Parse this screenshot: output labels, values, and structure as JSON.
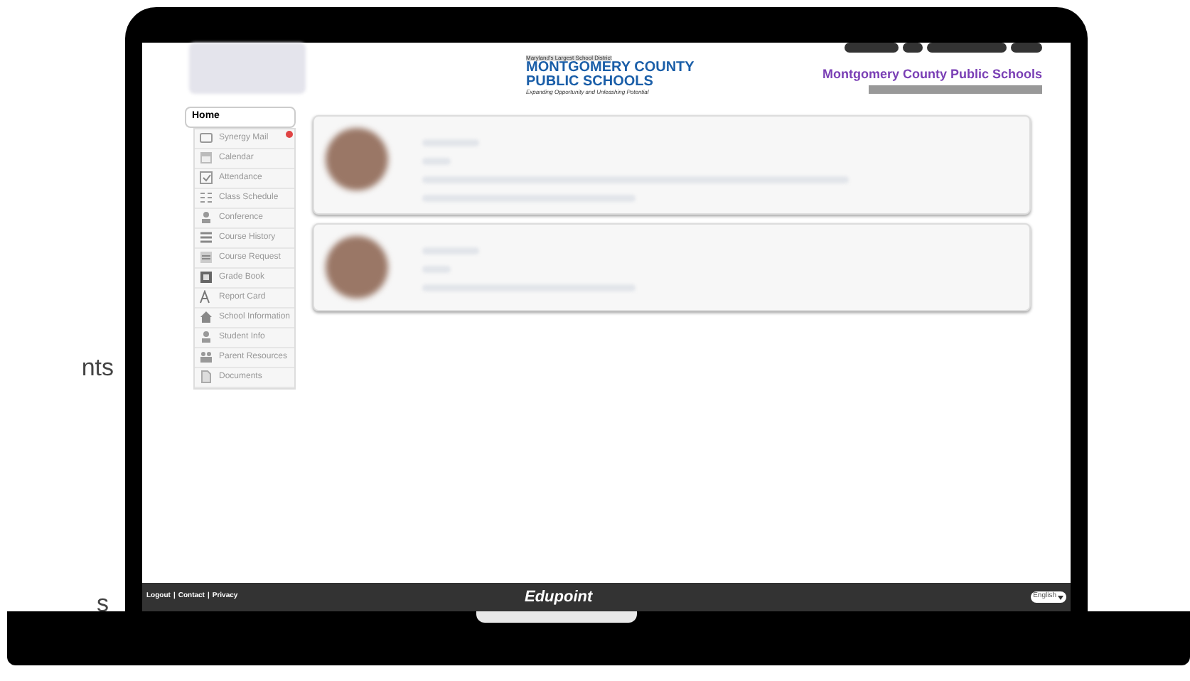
{
  "page_fragments": [
    "nts",
    "s"
  ],
  "header": {
    "logo": {
      "kicker": "Maryland's Largest School District",
      "line_1": "MONTGOMERY COUNTY",
      "line_2": "PUBLIC SCHOOLS",
      "tagline": "Expanding Opportunity and Unleashing Potential"
    },
    "title": "Montgomery County Public Schools"
  },
  "sidebar": {
    "home_tab": "Home",
    "items": [
      {
        "label": "Synergy Mail",
        "kind": "mail",
        "badge": true
      },
      {
        "label": "Calendar",
        "kind": "calendar",
        "badge": false
      },
      {
        "label": "Attendance",
        "kind": "check",
        "badge": false
      },
      {
        "label": "Class Schedule",
        "kind": "schedule",
        "badge": false
      },
      {
        "label": "Conference",
        "kind": "person",
        "badge": false
      },
      {
        "label": "Course History",
        "kind": "history",
        "badge": false
      },
      {
        "label": "Course Request",
        "kind": "request",
        "badge": false
      },
      {
        "label": "Grade Book",
        "kind": "book",
        "badge": false
      },
      {
        "label": "Report Card",
        "kind": "grade",
        "badge": false
      },
      {
        "label": "School Information",
        "kind": "school",
        "badge": false
      },
      {
        "label": "Student Info",
        "kind": "person",
        "badge": false
      },
      {
        "label": "Parent Resources",
        "kind": "people",
        "badge": false
      },
      {
        "label": "Documents",
        "kind": "document",
        "badge": false
      }
    ]
  },
  "footer": {
    "links": [
      "Logout",
      "Contact",
      "Privacy"
    ],
    "separator": "|",
    "brand": "Edupoint",
    "language": "English"
  }
}
